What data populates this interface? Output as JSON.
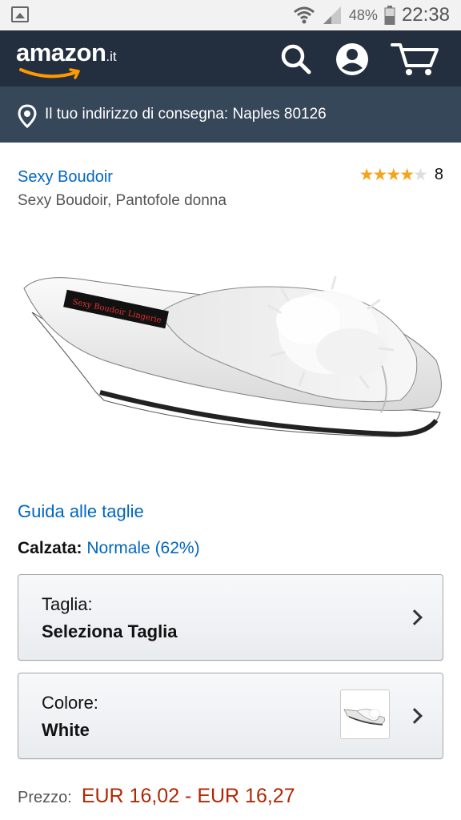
{
  "status_bar": {
    "battery_percent": "48%",
    "time": "22:38",
    "icons": [
      "gallery-icon",
      "wifi-icon",
      "signal-icon",
      "battery-icon"
    ]
  },
  "header": {
    "logo_word": "amazon",
    "logo_tld": ".it",
    "icons": [
      "search-icon",
      "account-icon",
      "cart-icon"
    ]
  },
  "delivery": {
    "text": "Il tuo indirizzo di consegna: Naples 80126"
  },
  "product": {
    "brand": "Sexy Boudoir",
    "title": "Sexy Boudoir, Pantofole donna",
    "rating_stars": 4,
    "rating_max": 5,
    "review_count": "8",
    "image_label": "Sexy Boudoir"
  },
  "size_guide": "Guida alle taglie",
  "fit": {
    "label": "Calzata:",
    "value": "Normale (62%)"
  },
  "size_selector": {
    "label": "Taglia:",
    "value": "Seleziona Taglia"
  },
  "color_selector": {
    "label": "Colore:",
    "value": "White"
  },
  "price": {
    "label": "Prezzo:",
    "value": "EUR 16,02 - EUR 16,27"
  },
  "colors": {
    "header_bg": "#232f3e",
    "delivery_bg": "#37475a",
    "link": "#0066c0",
    "price": "#b12704",
    "star": "#f4a41c",
    "logo_smile": "#ff9900"
  }
}
